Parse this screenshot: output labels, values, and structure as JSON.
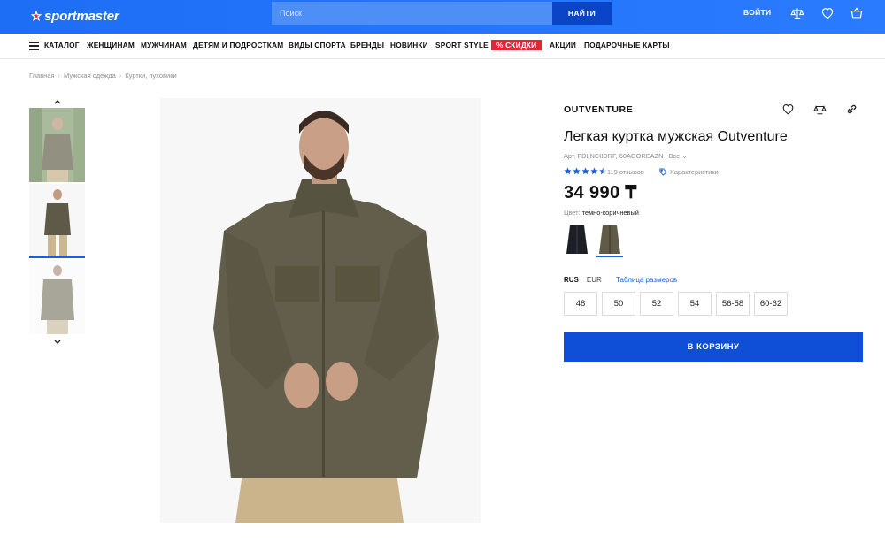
{
  "header": {
    "logo_text": "sportmaster",
    "search_placeholder": "Поиск",
    "search_button": "НАЙТИ",
    "login": "ВОЙТИ",
    "icons": [
      "compare-icon",
      "heart-icon",
      "cart-icon"
    ]
  },
  "nav": {
    "items": [
      "КАТАЛОГ",
      "ЖЕНЩИНАМ",
      "МУЖЧИНАМ",
      "ДЕТЯМ И ПОДРОСТКАМ",
      "ВИДЫ СПОРТА",
      "БРЕНДЫ",
      "НОВИНКИ",
      "SPORT STYLE",
      "% СКИДКИ",
      "АКЦИИ",
      "ПОДАРОЧНЫЕ КАРТЫ"
    ]
  },
  "breadcrumbs": [
    "Главная",
    "Мужская одежда",
    "Куртки, пуховики"
  ],
  "product": {
    "brand": "OUTVENTURE",
    "title": "Легкая куртка мужская Outventure",
    "article": "Арт. FDLNCIIDRF, 60AGOREAZN",
    "article_all": "Все",
    "rating_stars": 4.5,
    "reviews": "119 отзывов",
    "specs_link": "Характеристики",
    "price": "34 990 ₸",
    "color_label": "Цвет:",
    "color_value": "темно-коричневый",
    "size_system_active": "RUS",
    "size_system_other": "EUR",
    "size_table": "Таблица размеров",
    "sizes": [
      "48",
      "50",
      "52",
      "54",
      "56-58",
      "60-62"
    ],
    "cart_button": "В КОРЗИНУ"
  },
  "colors": {
    "brand_blue": "#1a6cf2",
    "button_blue": "#0f4fd7",
    "sale_red": "#e32636",
    "jacket_olive": "#5f5b48"
  }
}
